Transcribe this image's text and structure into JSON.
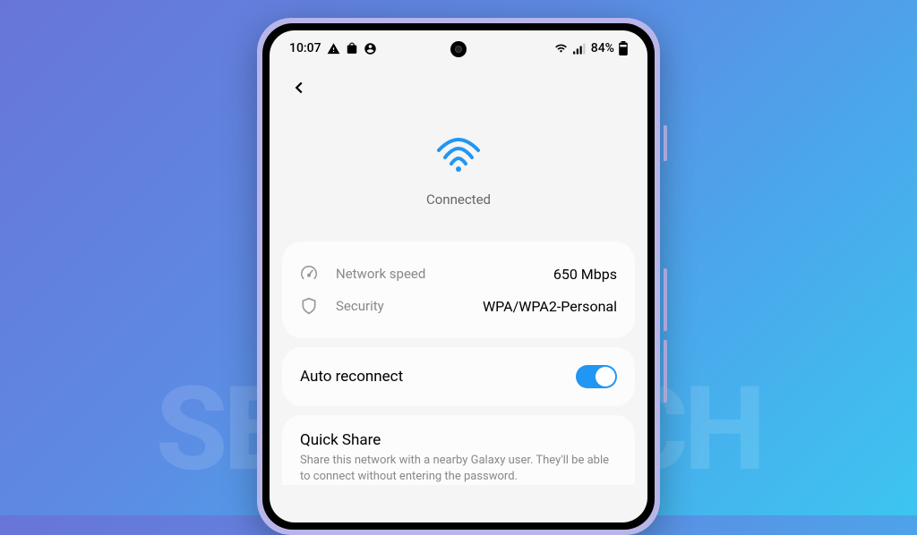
{
  "status_bar": {
    "time": "10:07",
    "battery_percent": "84%"
  },
  "wifi": {
    "status": "Connected"
  },
  "info": {
    "speed_label": "Network speed",
    "speed_value": "650 Mbps",
    "security_label": "Security",
    "security_value": "WPA/WPA2-Personal"
  },
  "settings": {
    "auto_reconnect_label": "Auto reconnect",
    "auto_reconnect_on": true
  },
  "quickshare": {
    "title": "Quick Share",
    "description": "Share this network with a nearby Galaxy user. They'll be able to connect without entering the password."
  },
  "watermark": "SEBERTECH"
}
